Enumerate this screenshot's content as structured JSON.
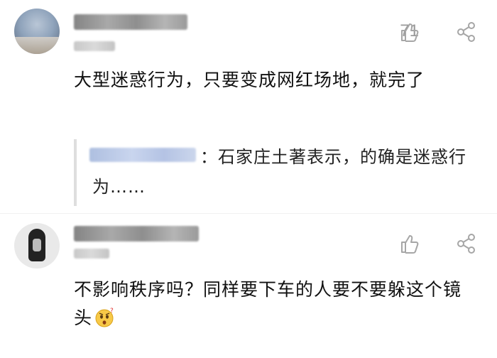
{
  "comments": [
    {
      "likes": "71",
      "text": "大型迷惑行为，只要变成网红场地，就完了",
      "reply": {
        "text": "：石家庄土著表示，的确是迷惑行为……"
      },
      "icons": {
        "like": "thumbs-up-icon",
        "share": "share-icon"
      }
    },
    {
      "text": "不影响秩序吗？同样要下车的人要不要躲这个镜头",
      "icons": {
        "like": "thumbs-up-icon",
        "share": "share-icon",
        "emoji": "confused-face-emoji"
      }
    }
  ],
  "colors": {
    "meta": "#9a9a9a",
    "text": "#111111",
    "reply_border": "#dedede"
  }
}
